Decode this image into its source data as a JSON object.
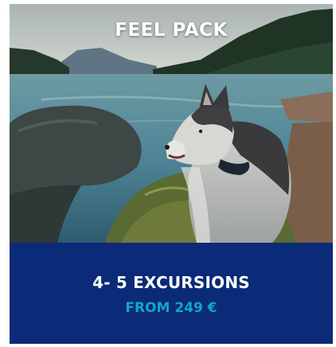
{
  "card": {
    "title": "FEEL PACK",
    "headline": "4- 5 EXCURSIONS",
    "price": "FROM 249 €"
  },
  "colors": {
    "panel": "#0b2a78",
    "price_accent": "#12a8c5",
    "title_text": "#ffffff"
  },
  "image": {
    "subject": "husky dog by a mountain lake"
  }
}
